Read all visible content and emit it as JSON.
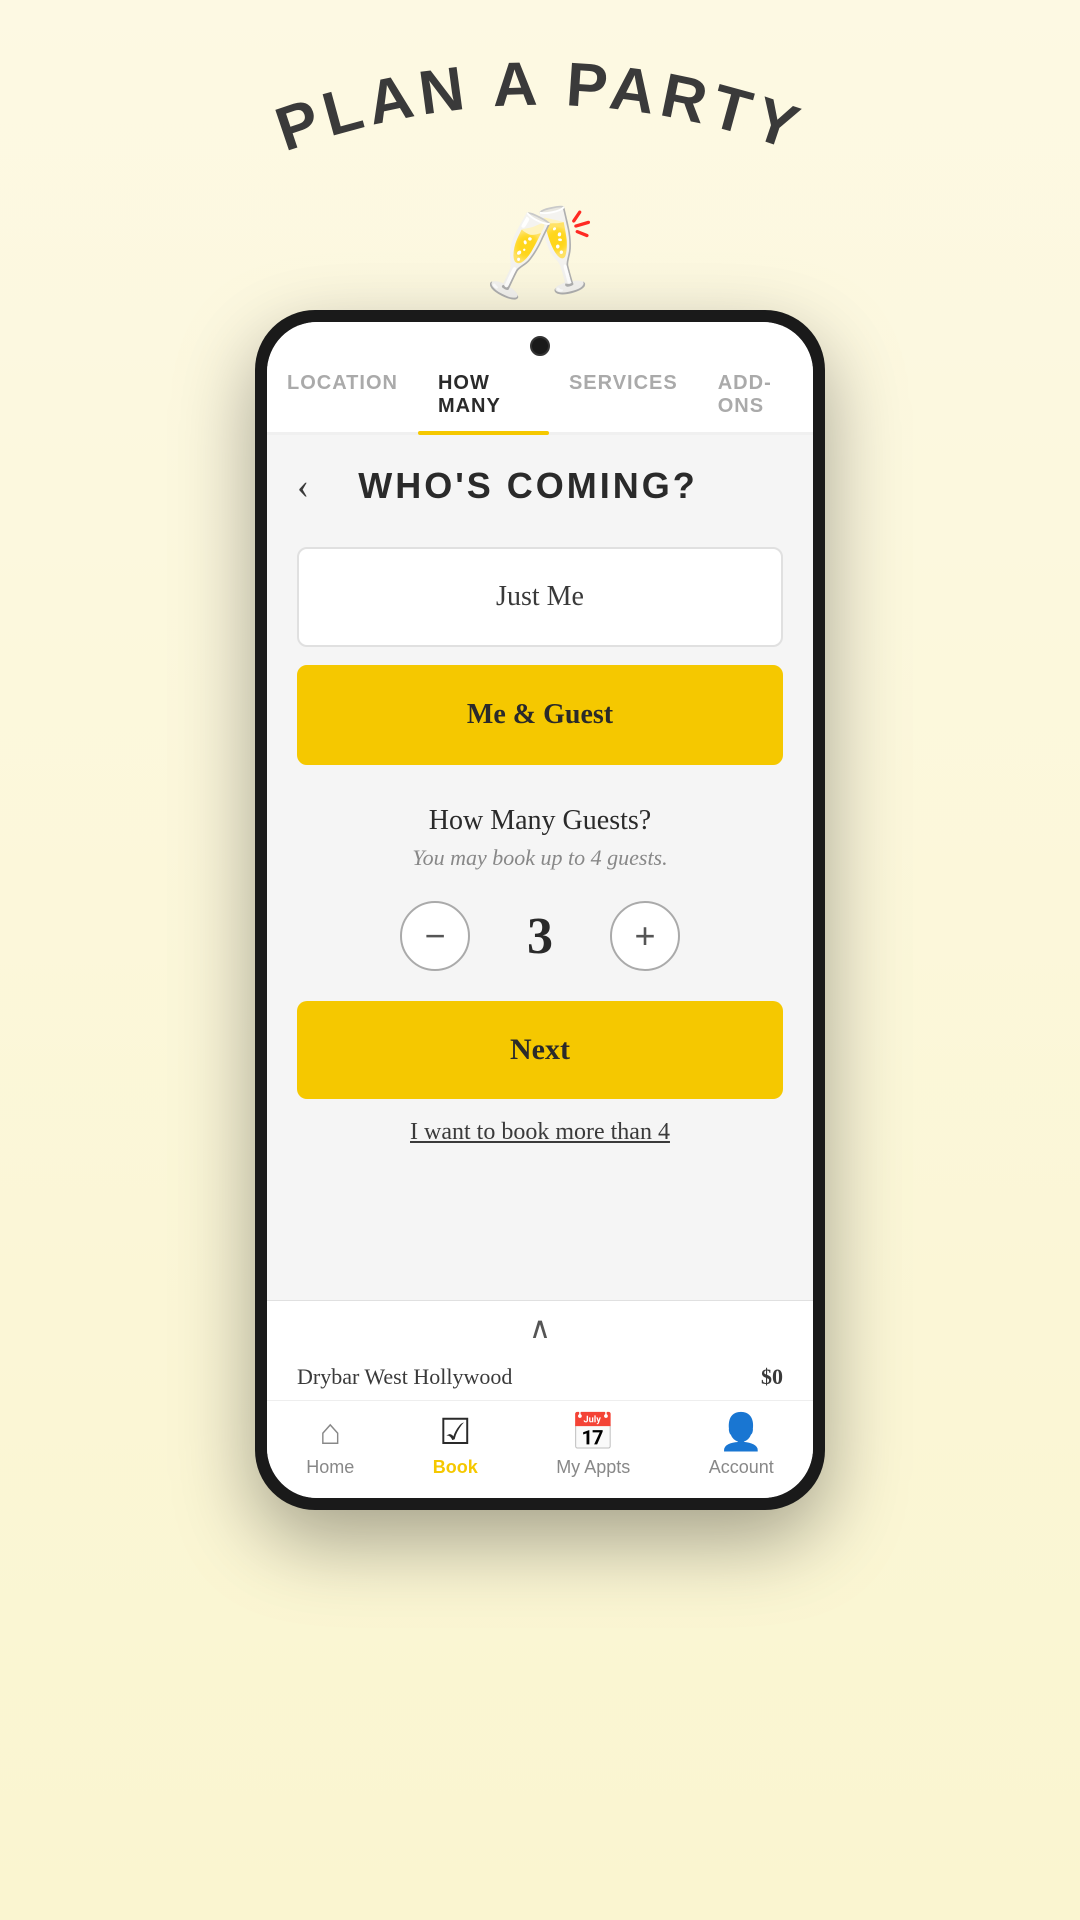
{
  "header": {
    "title": "PLAN A PARTY",
    "icon": "🥂"
  },
  "tabs": [
    {
      "id": "location",
      "label": "LOCATION",
      "active": false
    },
    {
      "id": "how-many",
      "label": "HOW MANY",
      "active": true
    },
    {
      "id": "services",
      "label": "SERVICES",
      "active": false
    },
    {
      "id": "add-ons",
      "label": "ADD-ONS",
      "active": false
    }
  ],
  "page": {
    "title": "WHO'S COMING?",
    "back_label": "‹"
  },
  "options": [
    {
      "id": "just-me",
      "label": "Just Me",
      "active": false
    },
    {
      "id": "me-guest",
      "label": "Me & Guest",
      "active": true
    }
  ],
  "guests": {
    "title": "How Many Guests?",
    "subtitle": "You may book up to 4 guests.",
    "count": "3",
    "decrement": "−",
    "increment": "+"
  },
  "next_button": {
    "label": "Next"
  },
  "more_link": {
    "label": "I want to book more than 4"
  },
  "bottom": {
    "chevron": "∧",
    "location": "Drybar West Hollywood",
    "price": "$0"
  },
  "nav": [
    {
      "id": "home",
      "label": "Home",
      "icon": "⌂",
      "active": false
    },
    {
      "id": "book",
      "label": "Book",
      "icon": "☑",
      "active": true
    },
    {
      "id": "my-appts",
      "label": "My Appts",
      "icon": "📅",
      "active": false
    },
    {
      "id": "account",
      "label": "Account",
      "icon": "👤",
      "active": false
    }
  ]
}
